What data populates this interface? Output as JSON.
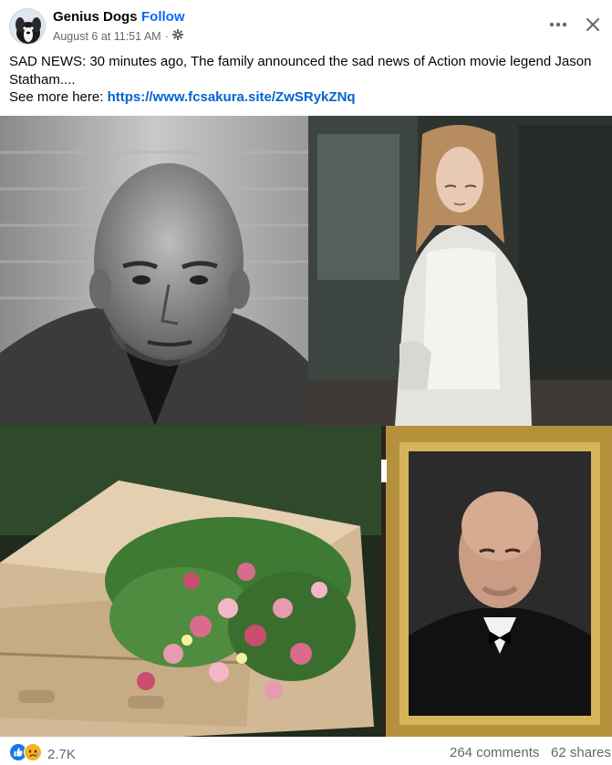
{
  "header": {
    "page_name": "Genius Dogs",
    "separator": "·",
    "follow_label": "Follow",
    "timestamp": "August 6 at 11:51 AM",
    "meta_separator": "·",
    "audience_icon": "settings-gear-icon",
    "more_icon": "more-dots-icon",
    "close_icon": "close-icon"
  },
  "caption": {
    "line1": "SAD NEWS: 30 minutes ago, The family announced the sad news of Action movie legend Jason Statham....",
    "see_more_prefix": "See more here: ",
    "link_text": "https://www.fcsakura.site/ZwSRykZNq"
  },
  "collage": {
    "panels": [
      "bw-portrait",
      "woman-walking",
      "flower-casket",
      "framed-portrait-with-cross"
    ]
  },
  "footer": {
    "reaction_icons": [
      "like-icon",
      "sad-icon"
    ],
    "reaction_count": "2.7K",
    "comments": "264 comments",
    "shares": "62 shares"
  },
  "colors": {
    "link": "#0064d1",
    "follow": "#0866ff",
    "secondary_text": "#65676b",
    "like_blue": "#1877f2",
    "sad_yellow": "#f7b125"
  }
}
